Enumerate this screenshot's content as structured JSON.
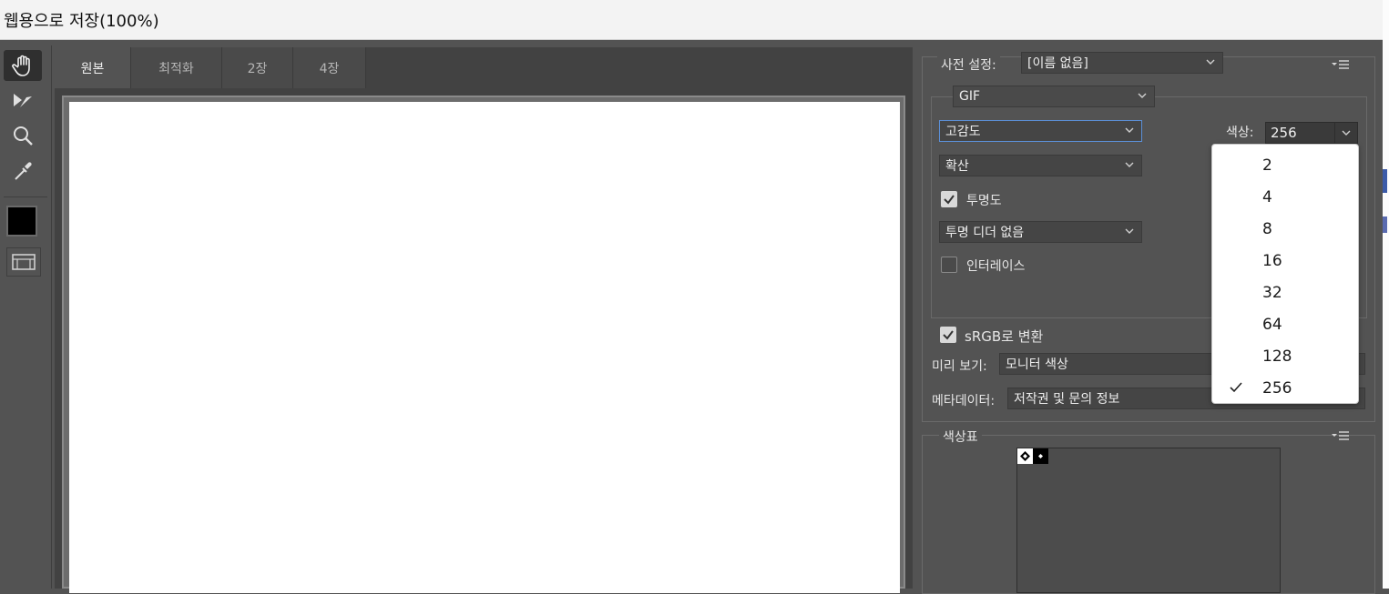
{
  "window": {
    "title": "웹용으로 저장(100%)"
  },
  "tools": [
    {
      "name": "hand-tool",
      "icon": "hand-icon"
    },
    {
      "name": "slice-select-tool",
      "icon": "slice-select-icon"
    },
    {
      "name": "zoom-tool",
      "icon": "magnifier-icon"
    },
    {
      "name": "eyedropper-tool",
      "icon": "eyedropper-icon"
    }
  ],
  "eyedropper_color": "#000000",
  "tabs": [
    {
      "label": "원본",
      "active": true
    },
    {
      "label": "최적화"
    },
    {
      "label": "2장"
    },
    {
      "label": "4장"
    }
  ],
  "settings": {
    "preset_label": "사전 설정:",
    "preset_value": "[이름 없음]",
    "format_value": "GIF",
    "reduction_value": "고감도",
    "dither_value": "확산",
    "transparency_label": "투명도",
    "transparency_checked": true,
    "transparency_dither_value": "투명 디더 없음",
    "interlace_label": "인터레이스",
    "interlace_checked": false,
    "colors_label": "색상:",
    "colors_value": "256",
    "srgb_label": "sRGB로 변환",
    "srgb_checked": true,
    "preview_label": "미리 보기:",
    "preview_value": "모니터 색상",
    "metadata_label": "메타데이터:",
    "metadata_value": "저작권 및 문의 정보"
  },
  "color_table": {
    "title": "색상표"
  },
  "colors_dropdown": {
    "options": [
      "2",
      "4",
      "8",
      "16",
      "32",
      "64",
      "128",
      "256"
    ],
    "selected": "256"
  }
}
